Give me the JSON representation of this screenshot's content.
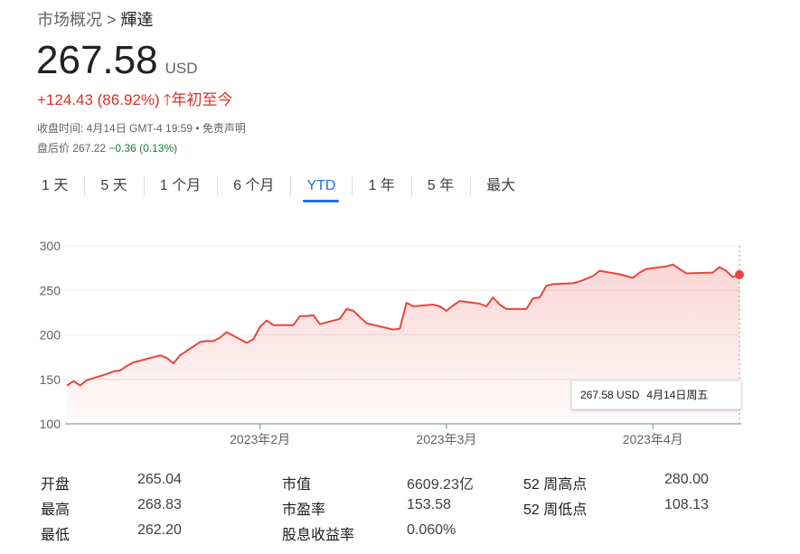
{
  "breadcrumb": {
    "root": "市场概况",
    "separator": ">",
    "current": "輝達"
  },
  "quote": {
    "price": "267.58",
    "currency": "USD",
    "change": "+124.43 (86.92%)",
    "change_arrow": "🡑",
    "change_period": "年初至今",
    "close_time": "收盘时间: 4月14日 GMT-4 19:59 • 免责声明",
    "after_hours_label": "盘后价",
    "after_hours_price": "267.22",
    "after_hours_change": "−0.36 (0.13%)"
  },
  "tabs": [
    {
      "label": "1 天"
    },
    {
      "label": "5 天"
    },
    {
      "label": "1 个月"
    },
    {
      "label": "6 个月"
    },
    {
      "label": "YTD",
      "active": true
    },
    {
      "label": "1 年"
    },
    {
      "label": "5 年"
    },
    {
      "label": "最大"
    }
  ],
  "colors": {
    "line": "#e8453c",
    "accent": "#1a73e8",
    "down": "#188038",
    "up": "#d93025"
  },
  "chart_data": {
    "type": "area",
    "yticks": [
      "300",
      "250",
      "200",
      "150",
      "100"
    ],
    "xticks": [
      "2023年2月",
      "2023年3月",
      "2023年4月"
    ],
    "ylim": [
      100,
      300
    ],
    "grid": true,
    "x": [
      "01-03",
      "01-04",
      "01-05",
      "01-06",
      "01-09",
      "01-10",
      "01-11",
      "01-12",
      "01-13",
      "01-17",
      "01-18",
      "01-19",
      "01-20",
      "01-23",
      "01-24",
      "01-25",
      "01-26",
      "01-27",
      "01-30",
      "01-31",
      "02-01",
      "02-02",
      "02-03",
      "02-06",
      "02-07",
      "02-08",
      "02-09",
      "02-10",
      "02-13",
      "02-14",
      "02-15",
      "02-16",
      "02-17",
      "02-21",
      "02-22",
      "02-23",
      "02-24",
      "02-27",
      "02-28",
      "03-01",
      "03-02",
      "03-03",
      "03-06",
      "03-07",
      "03-08",
      "03-09",
      "03-10",
      "03-13",
      "03-14",
      "03-15",
      "03-16",
      "03-17",
      "03-20",
      "03-21",
      "03-22",
      "03-23",
      "03-24",
      "03-27",
      "03-28",
      "03-29",
      "03-30",
      "03-31",
      "04-03",
      "04-04",
      "04-05",
      "04-06",
      "04-10",
      "04-11",
      "04-12",
      "04-13",
      "04-14"
    ],
    "values": [
      143,
      148,
      143,
      149,
      156,
      159,
      160,
      165,
      169,
      177,
      174,
      168,
      177,
      192,
      193,
      193,
      197,
      203,
      191,
      195,
      209,
      216,
      211,
      211,
      221,
      221,
      222,
      212,
      218,
      229,
      227,
      220,
      213,
      206,
      207,
      236,
      232,
      234,
      232,
      227,
      233,
      238,
      235,
      232,
      242,
      234,
      229,
      229,
      241,
      242,
      255,
      257,
      258,
      260,
      263,
      266,
      272,
      268,
      266,
      264,
      270,
      274,
      277,
      279,
      274,
      269,
      270,
      276,
      272,
      265,
      267.58
    ],
    "tooltip": {
      "value": "267.58 USD",
      "date": "4月14日周五"
    }
  },
  "stats": {
    "col1": [
      {
        "label": "开盘",
        "value": "265.04"
      },
      {
        "label": "最高",
        "value": "268.83"
      },
      {
        "label": "最低",
        "value": "262.20"
      }
    ],
    "col2": [
      {
        "label": "市值",
        "value": "6609.23亿"
      },
      {
        "label": "市盈率",
        "value": "153.58"
      },
      {
        "label": "股息收益率",
        "value": "0.060%"
      }
    ],
    "col3": [
      {
        "label": "52 周高点",
        "value": "280.00"
      },
      {
        "label": "52 周低点",
        "value": "108.13"
      }
    ]
  }
}
